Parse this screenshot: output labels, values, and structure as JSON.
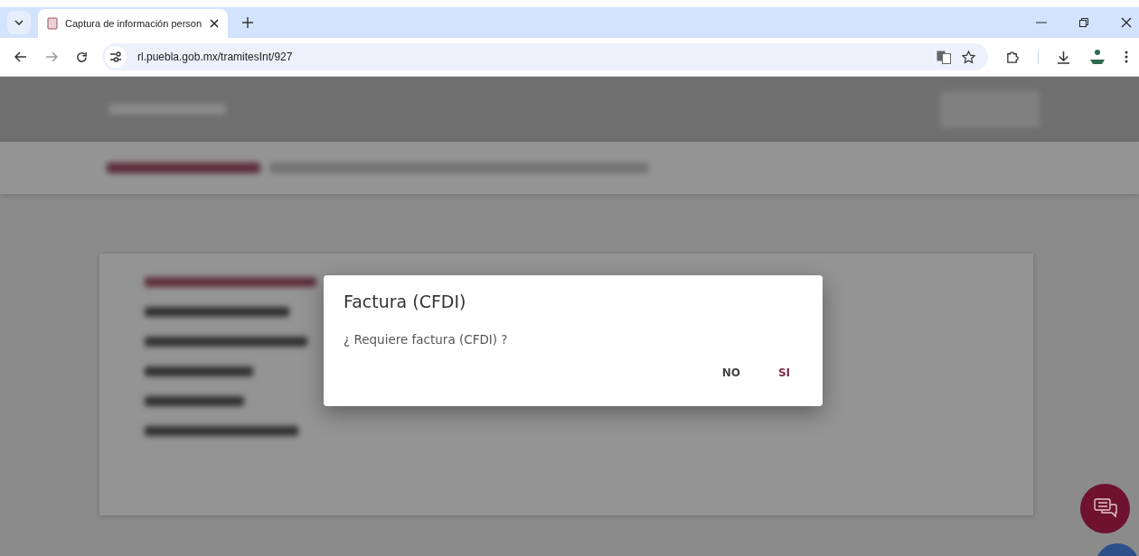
{
  "browser": {
    "tab_title": "Captura de información person",
    "url": "rl.puebla.gob.mx/tramitesInt/927"
  },
  "dialog": {
    "title": "Factura (CFDI)",
    "message": "¿ Requiere factura (CFDI) ?",
    "buttons": [
      {
        "label": "NO",
        "kind": "secondary"
      },
      {
        "label": "SI",
        "kind": "primary"
      }
    ]
  }
}
